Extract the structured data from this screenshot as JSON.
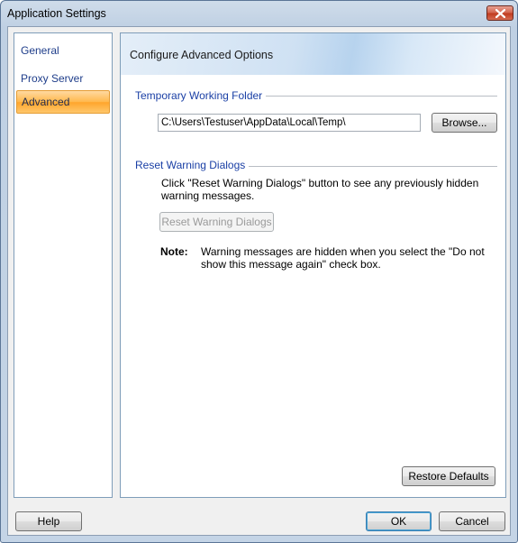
{
  "window": {
    "title": "Application Settings"
  },
  "nav": {
    "items": [
      {
        "label": "General",
        "selected": false
      },
      {
        "label": "Proxy Server",
        "selected": false
      },
      {
        "label": "Advanced",
        "selected": true
      }
    ]
  },
  "panel": {
    "header": "Configure Advanced Options",
    "temp_folder": {
      "label": "Temporary Working Folder",
      "path": "C:\\Users\\Testuser\\AppData\\Local\\Temp\\",
      "browse_label": "Browse..."
    },
    "reset": {
      "label": "Reset Warning Dialogs",
      "description": "Click \"Reset Warning Dialogs\" button to see any previously hidden warning messages.",
      "button_label": "Reset Warning Dialogs"
    },
    "note": {
      "label": "Note:",
      "text": "Warning messages are hidden when you select the \"Do not show this message again\" check box."
    },
    "restore_label": "Restore Defaults"
  },
  "footer": {
    "help_label": "Help",
    "ok_label": "OK",
    "cancel_label": "Cancel"
  },
  "colors": {
    "section_label": "#1a3fa5",
    "nav_text": "#1e3d8a",
    "selected_nav": "#ffb84d"
  }
}
